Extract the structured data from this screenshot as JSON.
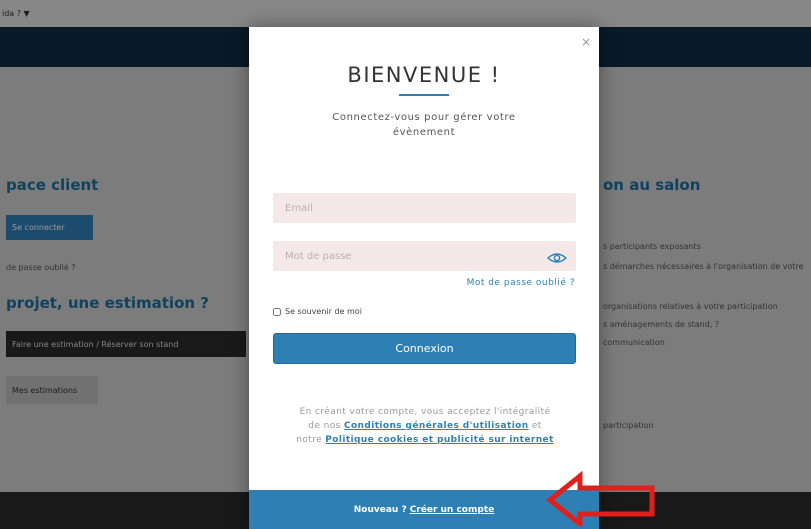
{
  "background": {
    "top_strip_text": "ida ? ▼",
    "left": {
      "heading1": "pace client",
      "connect_button": "Se connecter",
      "forgot_text": "de passe oublié ?",
      "heading2": "projet, une estimation ?",
      "estimate_button": "Faire une estimation / Réserver son stand",
      "estimates_button": "Mes estimations"
    },
    "right": {
      "heading": "on au salon",
      "lines": [
        "s participants exposants",
        "s démarches nécessaires à l'organisation de votre",
        "organisations relatives à votre participation",
        "s aménagements de stand, ?",
        "communication",
        "participation"
      ]
    }
  },
  "modal": {
    "close": "×",
    "title": "BIENVENUE !",
    "subtitle": "Connectez-vous pour gérer votre évènement",
    "email_placeholder": "Email",
    "password_placeholder": "Mot de passe",
    "forgot_password": "Mot de passe oublié ?",
    "remember_me": "Se souvenir de moi",
    "login_button": "Connexion",
    "legal": {
      "text1": "En créant votre compte, vous acceptez l'intégralité de nos",
      "link1": "Conditions générales d'utilisation",
      "text2": "et notre",
      "link2": "Politique cookies et publicité sur internet"
    },
    "footer": {
      "prefix": "Nouveau ?",
      "link": "Créer un compte"
    }
  },
  "colors": {
    "accent": "#2e7fb4",
    "arrow": "#e0201c",
    "field_bg": "#f5e8e8"
  },
  "icons": {
    "eye": "eye-icon",
    "arrow": "red-arrow-annotation"
  }
}
